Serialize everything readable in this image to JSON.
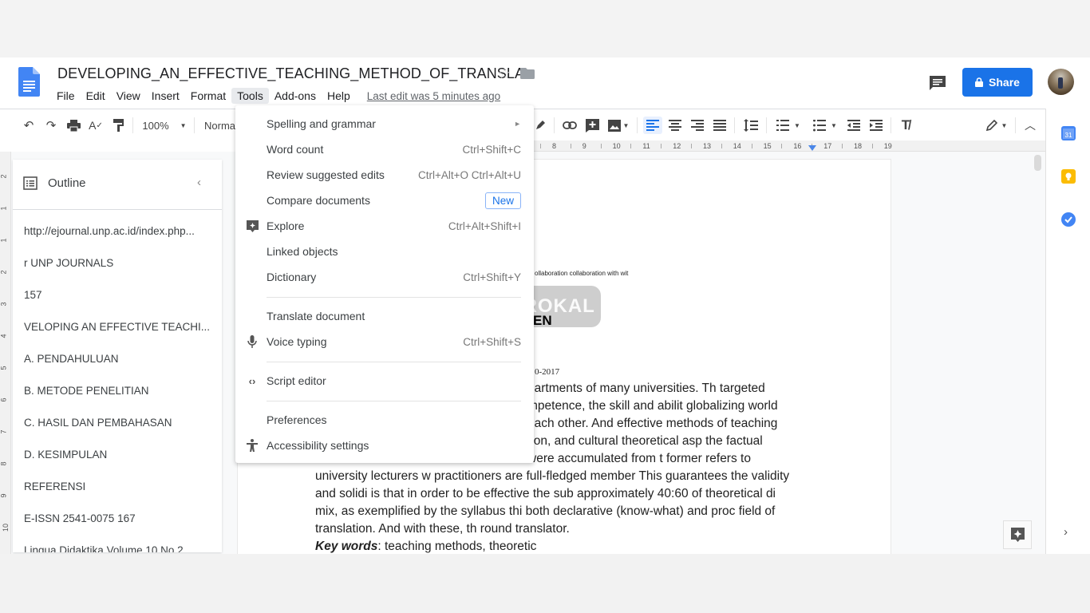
{
  "header": {
    "doc_title": "DEVELOPING_AN_EFFECTIVE_TEACHING_METHOD_OF_TRANSLA",
    "menu": [
      "File",
      "Edit",
      "View",
      "Insert",
      "Format",
      "Tools",
      "Add-ons",
      "Help"
    ],
    "active_menu": "Tools",
    "last_edit": "Last edit was 5 minutes ago",
    "share_label": "Share",
    "colors": {
      "share": "#1a73e8",
      "docs_blue": "#4285f4"
    }
  },
  "toolbar": {
    "zoom": "100%",
    "style": "Normal",
    "icons": [
      "undo-icon",
      "redo-icon",
      "print-icon",
      "spellcheck-icon",
      "paint-format-icon",
      "highlight-icon",
      "link-icon",
      "comment-add-icon",
      "image-icon",
      "align-left-icon",
      "align-center-icon",
      "align-right-icon",
      "align-justify-icon",
      "line-spacing-icon",
      "numbered-list-icon",
      "bulleted-list-icon",
      "decrease-indent-icon",
      "increase-indent-icon",
      "clear-format-icon",
      "editing-mode-icon",
      "collapse-icon"
    ]
  },
  "ruler": {
    "h_ticks": [
      "8",
      "9",
      "10",
      "11",
      "12",
      "13",
      "14",
      "15",
      "16",
      "17",
      "18",
      "19"
    ],
    "v_ticks": [
      "2",
      "1",
      "1",
      "2",
      "3",
      "4",
      "5",
      "6",
      "7",
      "8",
      "9",
      "10"
    ]
  },
  "outline": {
    "title": "Outline",
    "items": [
      "http://ejournal.unp.ac.id/index.php...",
      "r UNP JOURNALS",
      "157",
      "VELOPING AN EFFECTIVE TEACHI...",
      "A. PENDAHULUAN",
      "B. METODE PENELITIAN",
      "C. HASIL DAN PEMBAHASAN",
      "D. KESIMPULAN",
      "REFERENSI",
      "E-ISSN 2541-0075 167",
      "Lingua Didaktika Volume 10 No 2"
    ]
  },
  "tools_menu": {
    "items": [
      {
        "label": "Spelling and grammar",
        "shortcut": "",
        "submenu": true,
        "icon": ""
      },
      {
        "label": "Word count",
        "shortcut": "Ctrl+Shift+C",
        "icon": ""
      },
      {
        "label": "Review suggested edits",
        "shortcut": "Ctrl+Alt+O Ctrl+Alt+U",
        "icon": ""
      },
      {
        "label": "Compare documents",
        "badge": "New",
        "icon": ""
      },
      {
        "label": "Explore",
        "shortcut": "Ctrl+Alt+Shift+I",
        "icon": "explore-icon"
      },
      {
        "label": "Linked objects",
        "shortcut": "",
        "icon": ""
      },
      {
        "label": "Dictionary",
        "shortcut": "Ctrl+Shift+Y",
        "icon": ""
      },
      {
        "label": "Translate document",
        "shortcut": "",
        "icon": ""
      },
      {
        "label": "Voice typing",
        "shortcut": "Ctrl+Shift+S",
        "icon": "microphone-icon"
      },
      {
        "label": "Script editor",
        "shortcut": "",
        "icon": "code-icon"
      },
      {
        "label": "Preferences",
        "shortcut": "",
        "icon": ""
      },
      {
        "label": "Accessibility settings",
        "shortcut": "",
        "icon": "accessibility-icon"
      }
    ]
  },
  "document": {
    "small_line": "ollaboration collaboration with wit",
    "heading_fragment": "EN",
    "date_fragment": "0-2017",
    "watermark": "BEROKAL",
    "lines": [
      "partments of many universities. Th targeted",
      "mpetence, the skill and abilit globalizing world",
      "each other. And effective methods of teaching",
      "tion, and cultural theoretical asp the factual",
      "were accumulated from t former refers to",
      "university lecturers w practitioners are full-fledged member This guarantees the validity",
      "and solidi is that in order to be effective the sub approximately 40:60 of theoretical di",
      "mix, as exemplified by the syllabus thi both declarative (know-what) and proc field of",
      "translation. And with these, th round translator."
    ],
    "keywords_label": "Key words",
    "keywords_text": ": teaching methods, theoretic"
  }
}
